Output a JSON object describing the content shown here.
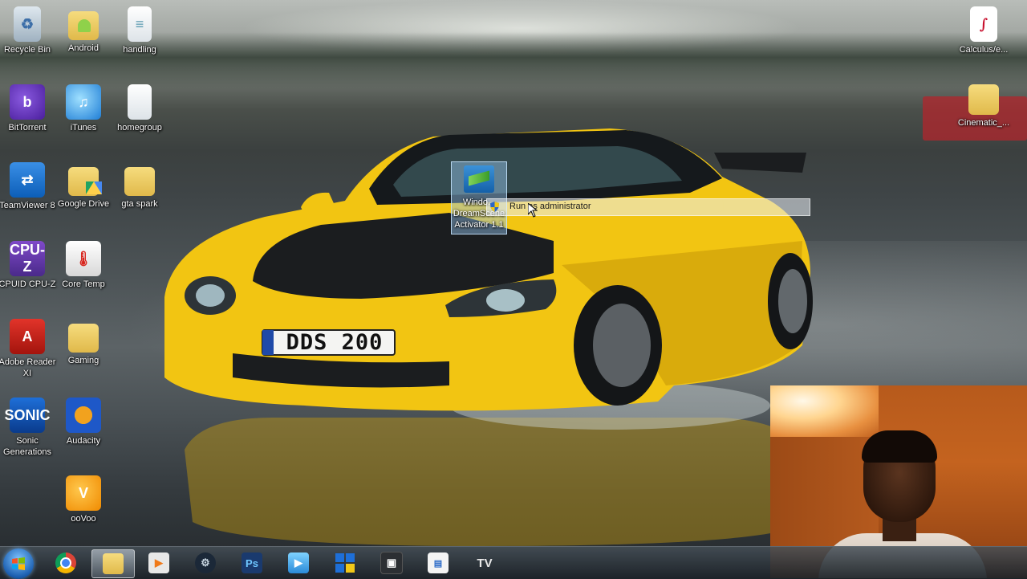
{
  "desktop": {
    "icons_left": [
      {
        "label": "Recycle Bin",
        "icon": "recycle-bin-icon"
      },
      {
        "label": "Android",
        "icon": "folder-icon"
      },
      {
        "label": "handling",
        "icon": "file-icon"
      },
      {
        "label": "BitTorrent",
        "icon": "bittorrent-icon"
      },
      {
        "label": "iTunes",
        "icon": "itunes-icon"
      },
      {
        "label": "homegroup",
        "icon": "file-icon"
      },
      {
        "label": "TeamViewer 8",
        "icon": "teamviewer-icon"
      },
      {
        "label": "Google Drive",
        "icon": "google-drive-folder-icon"
      },
      {
        "label": "gta spark",
        "icon": "folder-icon"
      },
      {
        "label": "CPUID CPU-Z",
        "icon": "cpuz-icon"
      },
      {
        "label": "Core Temp",
        "icon": "core-temp-icon"
      },
      {
        "label": "Adobe Reader XI",
        "icon": "adobe-reader-icon"
      },
      {
        "label": "Gaming",
        "icon": "folder-icon"
      },
      {
        "label": "Sonic Generations",
        "icon": "sonic-icon"
      },
      {
        "label": "Audacity",
        "icon": "audacity-icon"
      },
      {
        "label": "ooVoo",
        "icon": "oovoo-icon"
      }
    ],
    "icons_right": [
      {
        "label": "Calculus/e...",
        "icon": "pdf-file-icon"
      },
      {
        "label": "Cinematic_...",
        "icon": "folder-icon"
      }
    ],
    "dragged_icon_label": "Windows DreamScene Activator 1.1",
    "dragged_icon_label_visible": "Windo... DreamScene Activator 1.1",
    "tooltip_text": "Run as administrator",
    "plate_text": "DDS 200",
    "glyphs": {
      "bittorrent": "b",
      "itunes": "♫",
      "teamviewer": "⇄",
      "cpuz": "CPU-Z",
      "coretemp": "🌡",
      "adobe": "A",
      "sonic": "SONIC",
      "oovoo": "V",
      "calc": "∫",
      "recycle": "♻",
      "file": "≡"
    }
  },
  "taskbar": {
    "buttons": [
      {
        "name": "start-button",
        "icon": "windows-start-icon"
      },
      {
        "name": "chrome",
        "icon": "chrome-icon"
      },
      {
        "name": "file-explorer",
        "icon": "folder-icon",
        "active": true
      },
      {
        "name": "media-player",
        "icon": "media-player-icon"
      },
      {
        "name": "steam",
        "icon": "steam-icon"
      },
      {
        "name": "photoshop",
        "icon": "photoshop-icon",
        "label": "Ps"
      },
      {
        "name": "video-player",
        "icon": "play-icon"
      },
      {
        "name": "windows-app",
        "icon": "windows-tiles-icon"
      },
      {
        "name": "media-app",
        "icon": "media-app-icon"
      },
      {
        "name": "document-app",
        "icon": "document-icon"
      },
      {
        "name": "tv-app",
        "icon": "tv-icon",
        "label": "TV"
      }
    ]
  },
  "colors": {
    "car_yellow": "#f1c40f",
    "taskbar": "#2b343c",
    "selection": "#96c8f0"
  }
}
